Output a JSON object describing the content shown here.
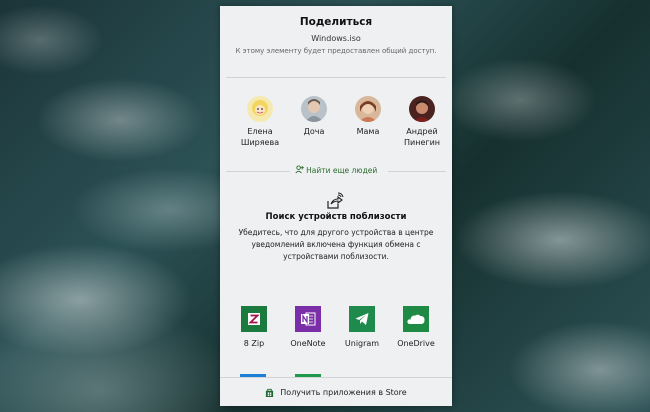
{
  "share": {
    "title": "Поделиться",
    "file_name": "Windows.iso",
    "subtitle": "К этому элементу будет предоставлен общий доступ."
  },
  "contacts": [
    {
      "name_line1": "Елена",
      "name_line2": "Ширяева"
    },
    {
      "name_line1": "Доча",
      "name_line2": ""
    },
    {
      "name_line1": "Мама",
      "name_line2": ""
    },
    {
      "name_line1": "Андрей",
      "name_line2": "Пинегин"
    }
  ],
  "find_people": {
    "label": "Найти еще людей",
    "icon": "person-add-icon"
  },
  "nearby": {
    "icon": "nearby-share-icon",
    "title": "Поиск устройств поблизости",
    "description": "Убедитесь, что для другого устройства в центре уведомлений включена функция обмена с устройствами поблизости."
  },
  "apps": [
    {
      "label": "8 Zip",
      "icon": "8zip-icon",
      "color": "#1b7a3e"
    },
    {
      "label": "OneNote",
      "icon": "onenote-icon",
      "color": "#7a2fa8"
    },
    {
      "label": "Unigram",
      "icon": "unigram-icon",
      "color": "#1e8a4c"
    },
    {
      "label": "OneDrive",
      "icon": "onedrive-icon",
      "color": "#1f8a43"
    }
  ],
  "store": {
    "label": "Получить приложения в Store",
    "icon": "store-bag-icon"
  },
  "colors": {
    "accent_green": "#2c6b2f",
    "scroll_blue": "#1e7fd6",
    "scroll_green": "#1f9a4a"
  }
}
